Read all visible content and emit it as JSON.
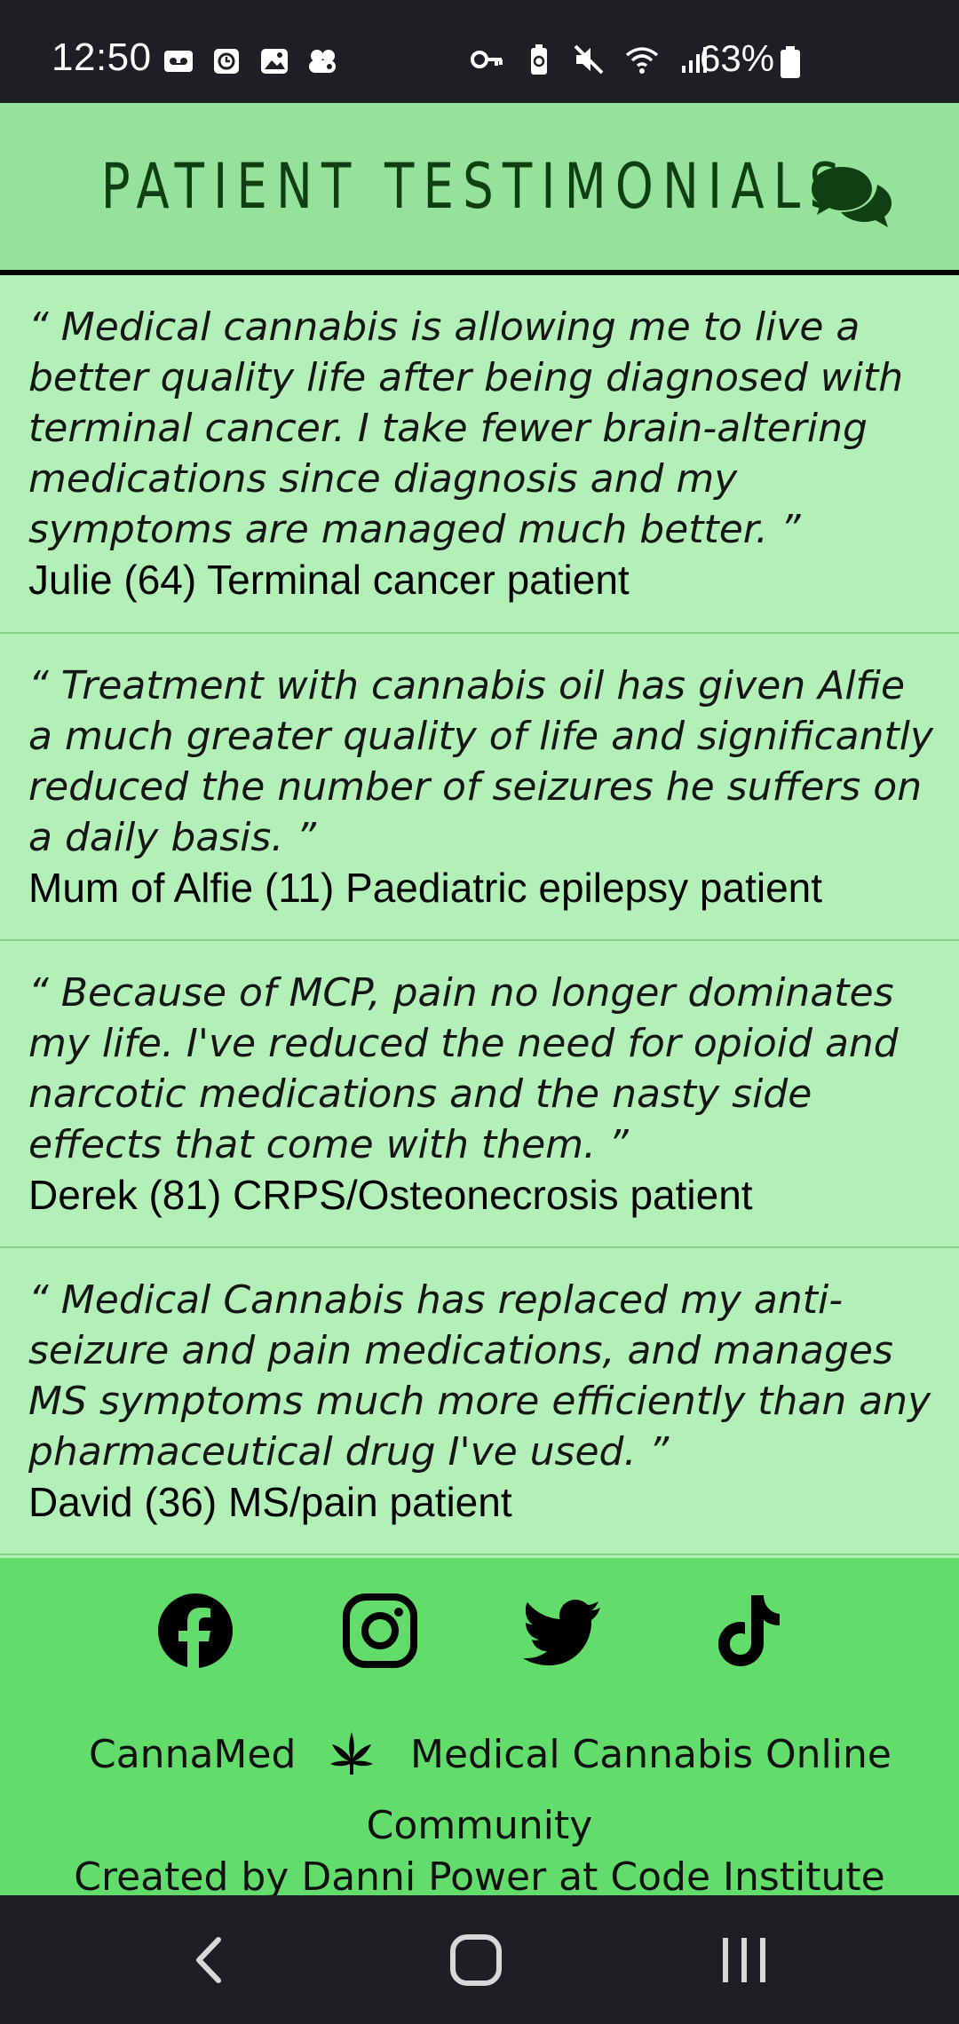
{
  "status_bar": {
    "time": "12:50",
    "battery_percent": "63%",
    "left_icons": [
      "voicemail-icon",
      "clock-app-icon",
      "gallery-icon",
      "game-icon"
    ],
    "right_icons": [
      "vpn-key-icon",
      "battery-saver-icon",
      "mute-icon",
      "wifi-icon",
      "signal-icon"
    ]
  },
  "header": {
    "title": "PATIENT TESTIMONIALS",
    "icon": "comments-icon"
  },
  "testimonials": [
    {
      "quote": "“ Medical cannabis is allowing me to live a better quality life after being diagnosed with terminal cancer. I take fewer brain-altering medications since diagnosis and my symptoms are managed much better. ”",
      "author": "Julie (64) Terminal cancer patient"
    },
    {
      "quote": "“ Treatment with cannabis oil has given Alfie a much greater quality of life and significantly reduced the number of seizures he suffers on a daily basis. ”",
      "author": "Mum of Alfie (11) Paediatric epilepsy patient"
    },
    {
      "quote": "“ Because of MCP, pain no longer dominates my life. I've reduced the need for opioid and narcotic medications and the nasty side effects that come with them. ”",
      "author": "Derek (81) CRPS/Osteonecrosis patient"
    },
    {
      "quote": "“ Medical Cannabis has replaced my anti-seizure and pain medications, and manages MS symptoms much more efficiently than any pharmaceutical drug I've used. ”",
      "author": "David (36) MS/pain patient"
    }
  ],
  "footer": {
    "social": [
      "facebook-icon",
      "instagram-icon",
      "twitter-icon",
      "tiktok-icon"
    ],
    "brand": "CannaMed",
    "tagline_part1": "Medical Cannabis Online",
    "tagline_part2": "Community",
    "credit": "Created by Danni Power at Code Institute"
  },
  "nav_bar": {
    "buttons": [
      "back-icon",
      "home-icon",
      "recents-icon"
    ]
  },
  "colors": {
    "header_bg": "#95e39a",
    "content_bg": "#b2f0b8",
    "footer_bg": "#62dc6a",
    "title_color": "#0f3f12",
    "system_bar_bg": "#1e1f24"
  }
}
